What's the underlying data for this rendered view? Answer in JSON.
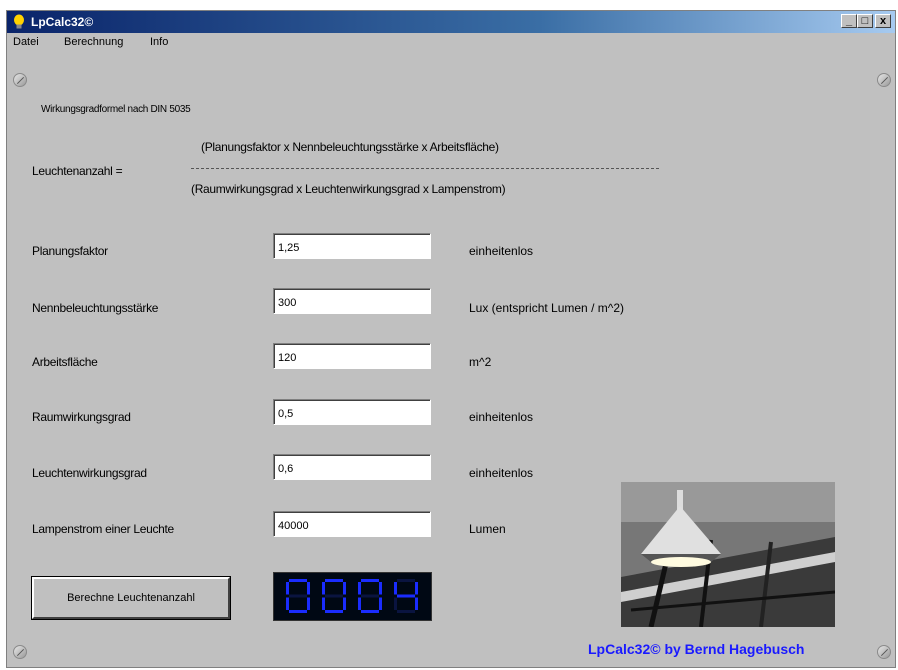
{
  "window": {
    "title": "LpCalc32©",
    "minimize_label": "_",
    "maximize_label": "□",
    "close_label": "x"
  },
  "menu": {
    "items": [
      "Datei",
      "Berechnung",
      "Info"
    ]
  },
  "formula": {
    "heading": "Wirkungsgradformel nach DIN 5035",
    "lhs": "Leuchtenanzahl =",
    "numerator": "(Planungsfaktor x Nennbeleuchtungsstärke x Arbeitsfläche)",
    "denominator": "(Raumwirkungsgrad x Leuchtenwirkungsgrad x Lampenstrom)"
  },
  "inputs": [
    {
      "label": "Planungsfaktor",
      "value": "1,25",
      "unit": "einheitenlos"
    },
    {
      "label": "Nennbeleuchtungsstärke",
      "value": "300",
      "unit": "Lux (entspricht Lumen / m^2)"
    },
    {
      "label": "Arbeitsfläche",
      "value": "120",
      "unit": "m^2"
    },
    {
      "label": "Raumwirkungsgrad",
      "value": "0,5",
      "unit": "einheitenlos"
    },
    {
      "label": "Leuchtenwirkungsgrad",
      "value": "0,6",
      "unit": "einheitenlos"
    },
    {
      "label": "Lampenstrom  einer Leuchte",
      "value": "40000",
      "unit": "Lumen"
    }
  ],
  "action": {
    "calculate_label": "Berechne Leuchtenanzahl"
  },
  "result": {
    "display": "0004",
    "color": "#1a2cff"
  },
  "credit": "LpCalc32© by Bernd Hagebusch",
  "colors": {
    "window_bg": "#c0c0c0",
    "credit": "#1a1aff"
  }
}
